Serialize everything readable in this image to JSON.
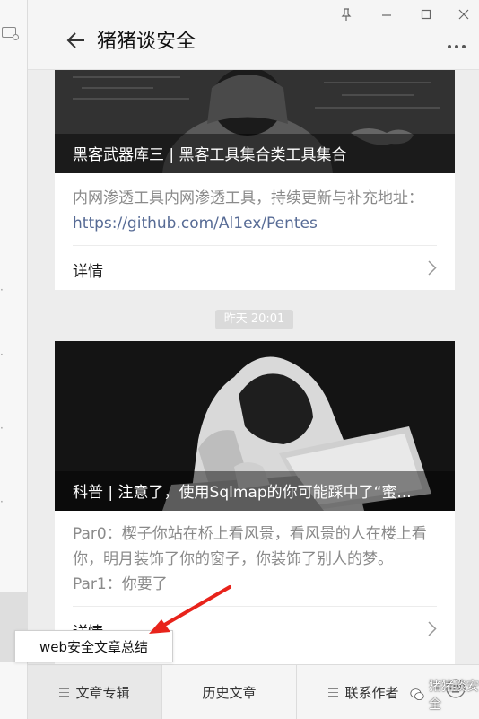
{
  "window": {
    "title": "猪猪谈安全"
  },
  "feed": {
    "articles": [
      {
        "title": "黑客武器库三 | 黑客工具集合类工具集合",
        "digest_text": "内网渗透工具内网渗透工具，持续更新与补充地址：",
        "digest_link": "https://github.com/Al1ex/Pentes",
        "detail_label": "详情"
      },
      {
        "title": "科普 | 注意了，使用Sqlmap的你可能踩中了“蜜...",
        "digest_text": "Par0：楔子你站在桥上看风景，看风景的人在楼上看你，明月装饰了你的窗子，你装饰了别人的梦。Par1：你要了",
        "detail_label": "详情"
      }
    ],
    "timestamp": "昨天 20:01"
  },
  "menu": {
    "items": [
      "文章专辑",
      "历史文章",
      "联系作者"
    ],
    "submenu": [
      "web安全文章总结"
    ]
  },
  "watermark": {
    "text": "猪猪谈安全"
  },
  "colors": {
    "link": "#576b95",
    "annotation_arrow": "#e8231b"
  }
}
